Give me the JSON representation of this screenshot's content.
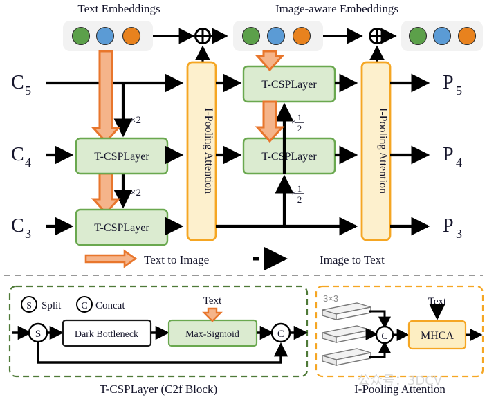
{
  "figure": {
    "title_top_left": "Text Embeddings",
    "title_top_right": "Image-aware Embeddings"
  },
  "colors": {
    "green_fill": "#dbebd0",
    "green_stroke": "#6aa84f",
    "yellow_fill": "#fdf0cd",
    "yellow_stroke": "#f5a623",
    "orange_arrow_fill": "#f5b48a",
    "orange_arrow_stroke": "#e8762c",
    "dot_green": "#5ca04a",
    "dot_blue": "#5b9bd5",
    "dot_orange": "#e8821e",
    "chip_bg": "#f2f2f2",
    "line": "#000000",
    "text": "#15152b",
    "watermark": "#c9c9c9"
  },
  "embeddings": {
    "left_chip_dots": [
      "dot_green",
      "dot_blue",
      "dot_orange"
    ],
    "mid_chip_dots": [
      "dot_green",
      "dot_blue",
      "dot_orange"
    ],
    "right_chip_dots": [
      "dot_green",
      "dot_blue",
      "dot_orange"
    ],
    "add_symbol": "oplus"
  },
  "inputs": [
    {
      "name": "C5",
      "base": "C",
      "sub": "5"
    },
    {
      "name": "C4",
      "base": "C",
      "sub": "4"
    },
    {
      "name": "C3",
      "base": "C",
      "sub": "3"
    }
  ],
  "outputs": [
    {
      "name": "P5",
      "base": "P",
      "sub": "5"
    },
    {
      "name": "P4",
      "base": "P",
      "sub": "4"
    },
    {
      "name": "P3",
      "base": "P",
      "sub": "3"
    }
  ],
  "blocks": {
    "tcsp_label": "T-CSPLayer",
    "ipool_label": "I-Pooling Attention",
    "left_tcsp": [
      "T-CSPLayer",
      "T-CSPLayer"
    ],
    "right_tcsp": [
      "T-CSPLayer",
      "T-CSPLayer"
    ]
  },
  "scale_labels": {
    "upsample_top": "×2",
    "upsample_bottom": "×2",
    "downsample_top_mul": "×",
    "downsample_top_num": "1",
    "downsample_top_den": "2",
    "downsample_bottom_mul": "×",
    "downsample_bottom_num": "1",
    "downsample_bottom_den": "2"
  },
  "legend": [
    {
      "key": "text-to-image",
      "label": "Text to Image",
      "style": "solid-orange-block-arrow"
    },
    {
      "key": "image-to-text",
      "label": "Image to Text",
      "style": "dashed-black-arrow"
    }
  ],
  "tcsp_panel": {
    "caption": "T-CSPLayer (C2f Block)",
    "key_split_symbol": "S",
    "key_split_label": "Split",
    "key_concat_symbol": "C",
    "key_concat_label": "Concat",
    "split_node": "S",
    "bottleneck_label": "Dark Bottleneck",
    "maxsigmoid_label": "Max-Sigmoid",
    "concat_node": "C",
    "text_input_label": "Text"
  },
  "ipool_panel": {
    "caption": "I-Pooling Attention",
    "pool_size_label": "3×3",
    "num_feature_maps": 3,
    "concat_node": "C",
    "mhca_label": "MHCA",
    "text_input_label": "Text"
  },
  "watermark": {
    "text": "公众号：3DCV"
  }
}
